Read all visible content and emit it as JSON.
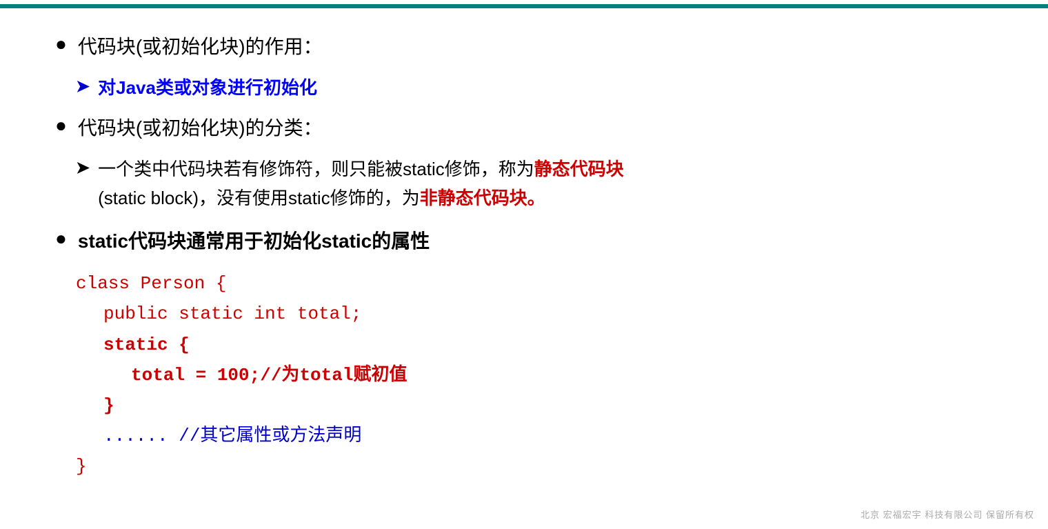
{
  "top_border_color": "#008080",
  "bullet1": {
    "dot": "●",
    "text": "代码块(或初始化块)的作用："
  },
  "sub1": {
    "arrow": "➤",
    "text_blue_bold": "对Java类或对象进行初始化"
  },
  "bullet2": {
    "dot": "●",
    "text": "代码块(或初始化块)的分类："
  },
  "sub2": {
    "arrow": "➤",
    "text_part1": "一个类中代码块若有修饰符，则只能被static修饰，称为",
    "text_red_bold": "静态代码块",
    "text_part2": "(static block)，没有使用static修饰的，为",
    "text_red_bold2": "非静态代码块。"
  },
  "bullet3": {
    "dot": "●",
    "text_bold": "static代码块通常用于初始化static的属性"
  },
  "code": {
    "line1": "class Person {",
    "line2": "    public static int total;",
    "line3_bold": "    static {",
    "line4_bold": "        total = 100;//为",
    "line4_bold2": "total",
    "line4_text": "赋初值",
    "line5_bold": "    }",
    "line6": "    ...... //其它属性或方法声明",
    "line7": "}"
  },
  "watermark": "北京 宏福宏宇 科技有限公司 保留所有权"
}
